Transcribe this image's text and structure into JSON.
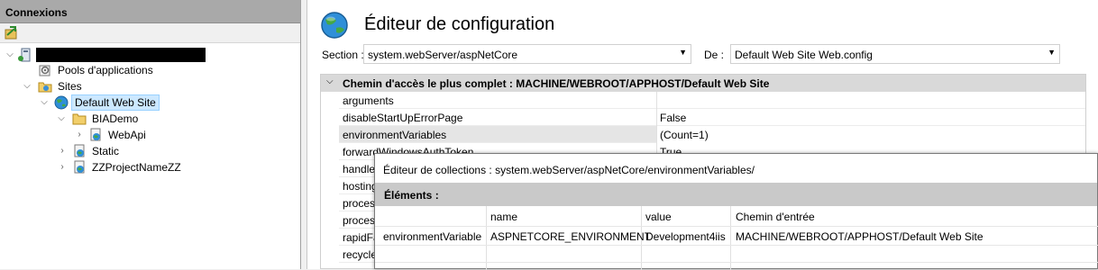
{
  "left_panel": {
    "header": "Connexions",
    "tree": [
      {
        "label": "Pools d'applications"
      },
      {
        "label": "Sites"
      },
      {
        "label": "Default Web Site"
      },
      {
        "label": "BIADemo"
      },
      {
        "label": "WebApi"
      },
      {
        "label": "Static"
      },
      {
        "label": "ZZProjectNameZZ"
      }
    ]
  },
  "right_panel": {
    "title": "Éditeur de configuration",
    "section_label": "Section :",
    "section_value": "system.webServer/aspNetCore",
    "de_label": "De :",
    "de_value": "Default Web Site Web.config",
    "path_header": "Chemin d'accès le plus complet : MACHINE/WEBROOT/APPHOST/Default Web Site",
    "rows": [
      {
        "key": "arguments",
        "value": ""
      },
      {
        "key": "disableStartUpErrorPage",
        "value": "False"
      },
      {
        "key": "environmentVariables",
        "value": "(Count=1)"
      },
      {
        "key": "forwardWindowsAuthToken",
        "value": "True"
      },
      {
        "key": "handle",
        "value": ""
      },
      {
        "key": "hosting",
        "value": ""
      },
      {
        "key": "process",
        "value": ""
      },
      {
        "key": "process",
        "value": ""
      },
      {
        "key": "rapidFa",
        "value": ""
      },
      {
        "key": "recycle",
        "value": ""
      }
    ]
  },
  "dialog": {
    "title": "Éditeur de collections : system.webServer/aspNetCore/environmentVariables/",
    "band": "Éléments :",
    "columns": [
      "name",
      "value",
      "Chemin d'entrée"
    ],
    "row": {
      "type": "environmentVariable",
      "name": "ASPNETCORE_ENVIRONMENT",
      "value": "Development4iis",
      "path": "MACHINE/WEBROOT/APPHOST/Default Web Site"
    }
  },
  "colors": {
    "selection": "#cce8ff",
    "header_gray": "#a9a9a9",
    "band_gray": "#c9c9c9"
  }
}
